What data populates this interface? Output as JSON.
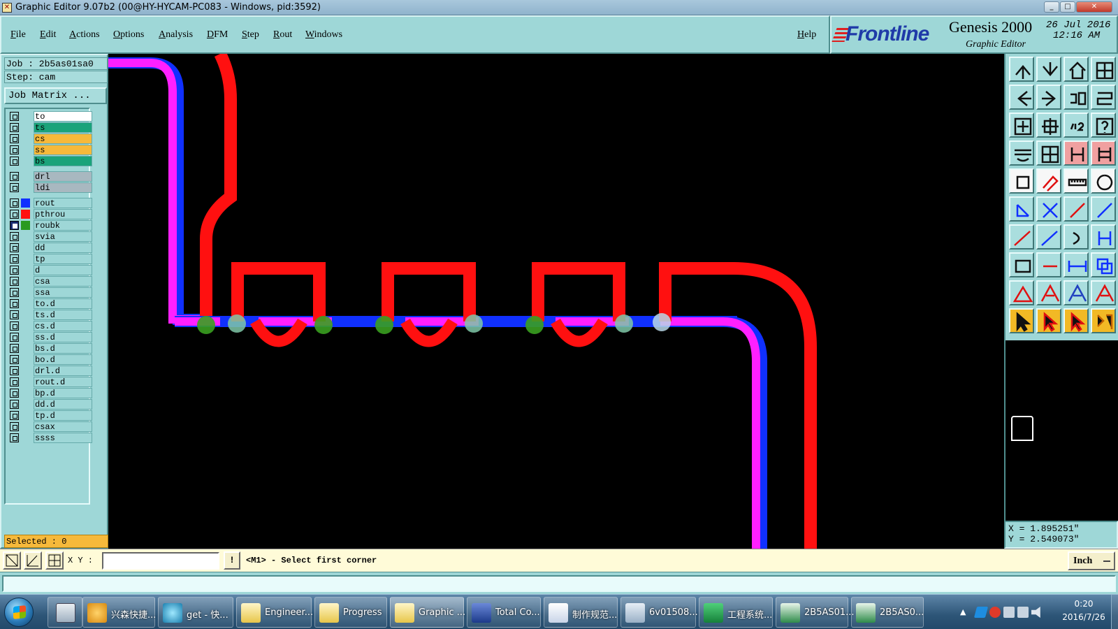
{
  "window": {
    "title": "Graphic Editor 9.07b2 (00@HY-HYCAM-PC083 - Windows, pid:3592)",
    "min": "_",
    "max": "□",
    "close": "✕"
  },
  "menu": {
    "file": {
      "first": "F",
      "rest": "ile"
    },
    "edit": {
      "first": "E",
      "rest": "dit"
    },
    "actions": {
      "first": "A",
      "rest": "ctions"
    },
    "options": {
      "first": "O",
      "rest": "ptions"
    },
    "analysis": {
      "first": "A",
      "rest": "nalysis"
    },
    "dfm": {
      "first": "D",
      "rest": "FM"
    },
    "step": {
      "first": "S",
      "rest": "tep"
    },
    "rout": {
      "first": "R",
      "rest": "out"
    },
    "windows": {
      "first": "W",
      "rest": "indows"
    },
    "help": {
      "first": "H",
      "rest": "elp"
    }
  },
  "brand": {
    "logo": "Frontline",
    "product": "Genesis 2000",
    "subtitle": "Graphic Editor",
    "date": "26 Jul 2016",
    "time": "12:16 AM"
  },
  "job": {
    "job_line": "Job : 2b5as01sa0",
    "step_line": "Step: cam",
    "matrix_button": "Job Matrix ..."
  },
  "layers": [
    {
      "name": "to",
      "bg": "#ffffff",
      "swatch": ""
    },
    {
      "name": "ts",
      "bg": "#1aa37a",
      "swatch": ""
    },
    {
      "name": "cs",
      "bg": "#f6b93b",
      "swatch": ""
    },
    {
      "name": "ss",
      "bg": "#f6b93b",
      "swatch": ""
    },
    {
      "name": "bs",
      "bg": "#1aa37a",
      "swatch": ""
    },
    {
      "name": "drl",
      "bg": "#a8b8c0",
      "swatch": ""
    },
    {
      "name": "ldi",
      "bg": "#a8b8c0",
      "swatch": ""
    },
    {
      "name": "rout",
      "bg": "#9ed7d7",
      "swatch": "#1030ff",
      "checked": false
    },
    {
      "name": "pthrou",
      "bg": "#9ed7d7",
      "swatch": "#ff1010",
      "checked": false
    },
    {
      "name": "roubk",
      "bg": "#9ed7d7",
      "swatch": "#2a9a20",
      "checked": true
    },
    {
      "name": "svia",
      "bg": "#9ed7d7",
      "swatch": ""
    },
    {
      "name": "dd",
      "bg": "#9ed7d7",
      "swatch": ""
    },
    {
      "name": "tp",
      "bg": "#9ed7d7",
      "swatch": ""
    },
    {
      "name": "d",
      "bg": "#9ed7d7",
      "swatch": ""
    },
    {
      "name": "csa",
      "bg": "#9ed7d7",
      "swatch": ""
    },
    {
      "name": "ssa",
      "bg": "#9ed7d7",
      "swatch": ""
    },
    {
      "name": "to.d",
      "bg": "#9ed7d7",
      "swatch": ""
    },
    {
      "name": "ts.d",
      "bg": "#9ed7d7",
      "swatch": ""
    },
    {
      "name": "cs.d",
      "bg": "#9ed7d7",
      "swatch": ""
    },
    {
      "name": "ss.d",
      "bg": "#9ed7d7",
      "swatch": ""
    },
    {
      "name": "bs.d",
      "bg": "#9ed7d7",
      "swatch": ""
    },
    {
      "name": "bo.d",
      "bg": "#9ed7d7",
      "swatch": ""
    },
    {
      "name": "drl.d",
      "bg": "#9ed7d7",
      "swatch": ""
    },
    {
      "name": "rout.d",
      "bg": "#9ed7d7",
      "swatch": ""
    },
    {
      "name": "bp.d",
      "bg": "#9ed7d7",
      "swatch": ""
    },
    {
      "name": "dd.d",
      "bg": "#9ed7d7",
      "swatch": ""
    },
    {
      "name": "tp.d",
      "bg": "#9ed7d7",
      "swatch": ""
    },
    {
      "name": "csax",
      "bg": "#9ed7d7",
      "swatch": ""
    },
    {
      "name": "ssss",
      "bg": "#9ed7d7",
      "swatch": ""
    }
  ],
  "selected": "Selected : 0",
  "coords": {
    "x": "X = 1.895251\"",
    "y": "Y = 2.549073\""
  },
  "command": {
    "xy_label": "X Y :",
    "xy_value": "",
    "bang": "!",
    "message": "<M1> - Select first corner",
    "units": "Inch"
  },
  "colors": {
    "rout": "#1030ff",
    "pthrou": "#ff1010",
    "highlight": "#ff20ff",
    "pad_green": "#3aa020",
    "pad_light": "#b8d8e8"
  },
  "taskbar": {
    "items": [
      {
        "label": "兴森快捷...",
        "icon": "leaf-icon"
      },
      {
        "label": "get - 快...",
        "icon": "eye-icon"
      },
      {
        "label": "Engineer...",
        "icon": "genesis-icon"
      },
      {
        "label": "Progress",
        "icon": "genesis-icon"
      },
      {
        "label": "Graphic ...",
        "icon": "genesis-icon"
      },
      {
        "label": "Total Co...",
        "icon": "floppy-icon"
      },
      {
        "label": "制作规范...",
        "icon": "document-icon"
      },
      {
        "label": "6v01508...",
        "icon": "folder-icon"
      },
      {
        "label": "工程系统...",
        "icon": "f-app-icon"
      },
      {
        "label": "2B5AS01...",
        "icon": "excel-icon"
      },
      {
        "label": "2B5AS0...",
        "icon": "excel-icon"
      }
    ],
    "clock_time": "0:20",
    "clock_date": "2016/7/26"
  }
}
